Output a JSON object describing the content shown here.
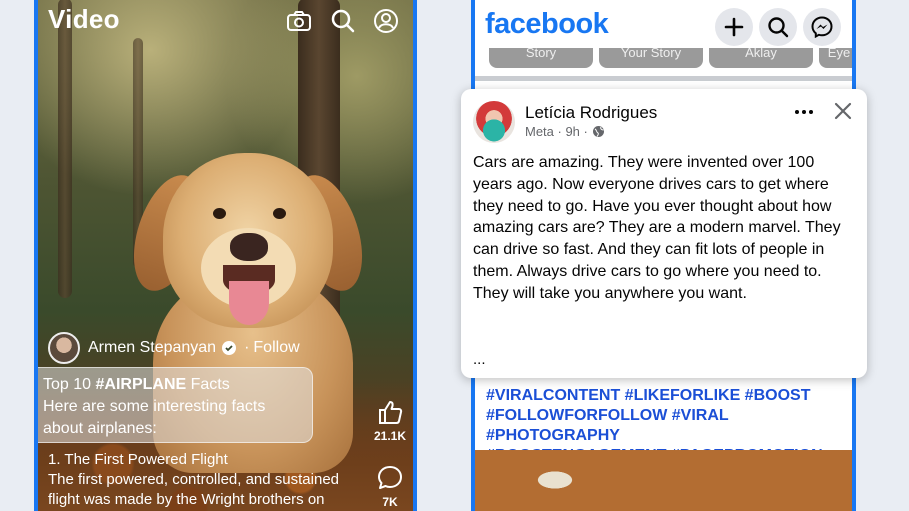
{
  "video": {
    "title": "Video",
    "header_icons": [
      "camera-icon",
      "search-icon",
      "profile-icon"
    ],
    "author": {
      "name": "Armen Stepanyan",
      "follow": "Follow",
      "separator": "·"
    },
    "caption": {
      "prefix": "Top 10 ",
      "hashtag": "#AIRPLANE",
      "suffix": " Facts",
      "line2": "Here are some interesting facts",
      "line3": "about airplanes:"
    },
    "facts": {
      "heading": "1. The First Powered Flight",
      "line1": "The first powered, controlled, and sustained",
      "line2": "flight was made by the Wright brothers on"
    },
    "actions": {
      "likes": "21.1K",
      "comments": "7K"
    }
  },
  "facebook": {
    "logo": "facebook",
    "header_icons": [
      "plus-icon",
      "search-icon",
      "messenger-icon"
    ],
    "stories": [
      "Story",
      "Your Story",
      "Aklay",
      "Eye"
    ],
    "hashtags": [
      "#VIRALCONTENT #LIKEFORLIKE #BOOST",
      "#FOLLOWFORFOLLOW #VIRAL #PHOTOGRAPHY",
      "#BOOSTENGAGEMENT #PAGEPROMOTION"
    ]
  },
  "post": {
    "author": "Letícia Rodrigues",
    "meta": "Meta · 9h ·",
    "body_lines": [
      "Cars are amazing. They were invented over 100",
      "years ago. Now everyone drives cars to get where",
      "they need to go. Have you ever thought about how",
      "amazing cars are? They are a modern marvel. They",
      "can drive so fast. And they can fit lots of people in",
      "them. Always drive cars to go where you need to.",
      "They will take you anywhere you want."
    ],
    "ellipsis": "..."
  },
  "colors": {
    "brand_blue": "#1877f2",
    "hashtag_blue": "#1b4fd6",
    "icon_bg": "#e4e6eb"
  }
}
